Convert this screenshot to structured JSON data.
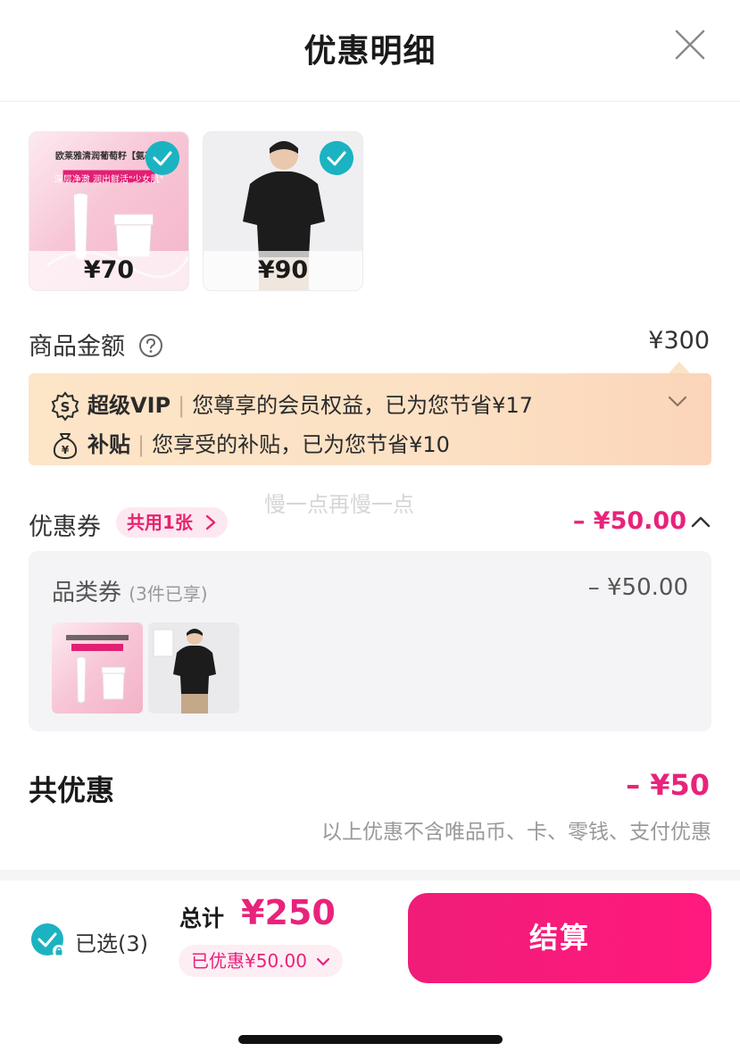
{
  "header": {
    "title": "优惠明细"
  },
  "products": [
    {
      "price": "¥70",
      "banner_brand": "欧莱雅清润葡萄籽【氨基洁",
      "banner_sub": "深层净澈 润出鲜活\"少女肌\""
    },
    {
      "price": "¥90"
    }
  ],
  "goods_amount": {
    "label": "商品金额",
    "value": "¥300"
  },
  "benefits": {
    "vip": {
      "tag": "超级VIP",
      "text": "您尊享的会员权益，已为您节省¥17"
    },
    "subsidy": {
      "tag": "补贴",
      "text": "您享受的补贴，已为您节省¥10"
    }
  },
  "watermark": "慢一点再慢一点",
  "coupon": {
    "label": "优惠券",
    "pill": "共用1张",
    "value": "– ¥50.00",
    "category": {
      "label": "品类券",
      "note": "(3件已享)",
      "value": "– ¥50.00"
    }
  },
  "total_discount": {
    "label": "共优惠",
    "value": "– ¥50",
    "note": "以上优惠不含唯品币、卡、零钱、支付优惠"
  },
  "footer": {
    "selected": "已选(3)",
    "sum_label": "总计",
    "sum_value": "¥250",
    "saved": "已优惠¥50.00",
    "checkout": "结算"
  },
  "colors": {
    "accent": "#e8237b",
    "check": "#1bb3c1",
    "vip_bg": "#fce1c4"
  }
}
